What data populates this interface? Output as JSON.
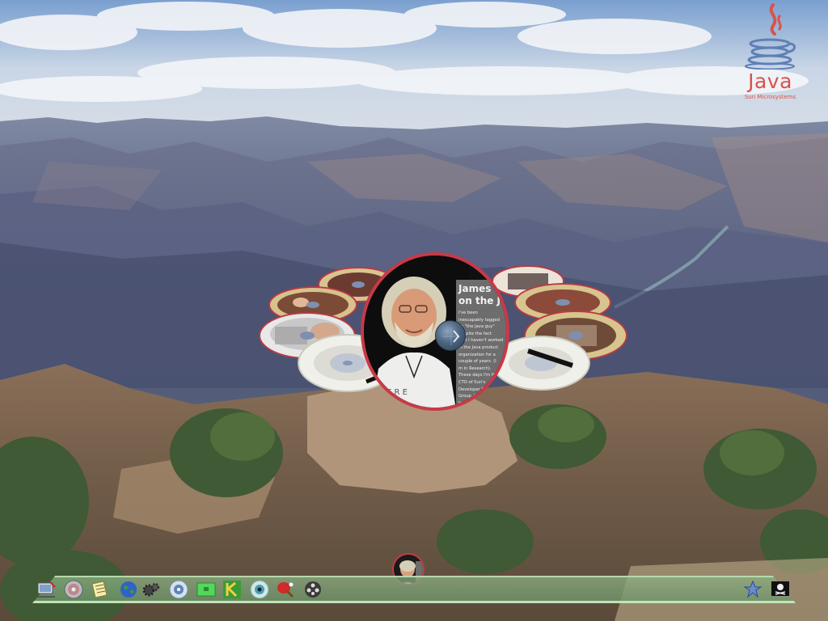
{
  "branding": {
    "logo_word": "Java",
    "logo_sub": "Sun Microsystems"
  },
  "carousel": {
    "focused_item": {
      "article_title": "James Go\non the Jav",
      "article_body": "I've been\ninescapably tagged\nas \"the Java guy\"\ndespite the fact\nthat I haven't worked\nin the Java product\norganization for a\ncouple of years. (I\nm in Research).\nThese days I'm the\nCTO of Sun's\nDeveloper Prod\nGroup. With\nfarewell"
    }
  },
  "taskbar": {
    "icons": [
      {
        "name": "monitor-pen-icon"
      },
      {
        "name": "cd-disc-icon"
      },
      {
        "name": "notepad-icon"
      },
      {
        "name": "globe-icon"
      },
      {
        "name": "gears-icon"
      },
      {
        "name": "network-icon"
      },
      {
        "name": "green-screen-icon"
      },
      {
        "name": "k-logo-icon"
      },
      {
        "name": "eye-icon"
      },
      {
        "name": "pingpong-icon"
      },
      {
        "name": "film-reel-icon"
      },
      {
        "name": "recycle-star-icon"
      },
      {
        "name": "pirate-flag-icon"
      }
    ]
  }
}
